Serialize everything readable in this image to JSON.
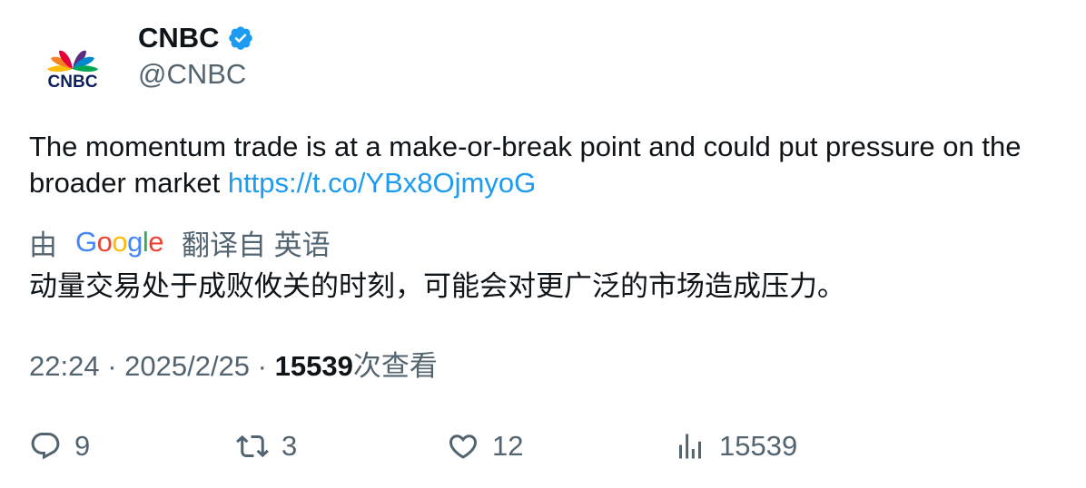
{
  "author": {
    "logo_text": "CNBC",
    "name": "CNBC",
    "handle": "@CNBC",
    "verified": true
  },
  "tweet": {
    "text": "The momentum trade is at a make-or-break point and could put pressure on the broader market ",
    "link": "https://t.co/YBx8OjmyoG"
  },
  "translation": {
    "prefix": "由",
    "provider": "Google",
    "suffix": "翻译自 英语",
    "text": "动量交易处于成败攸关的时刻，可能会对更广泛的市场造成压力。"
  },
  "meta": {
    "time": "22:24",
    "separator": " · ",
    "date": "2025/2/25",
    "views_count": "15539",
    "views_label": "次查看"
  },
  "actions": {
    "replies": "9",
    "retweets": "3",
    "likes": "12",
    "views": "15539"
  },
  "colors": {
    "text": "#0f1419",
    "secondary": "#536471",
    "link": "#1d9bf0",
    "verified": "#1d9bf0",
    "google_blue": "#4285f4",
    "google_red": "#ea4335",
    "google_yellow": "#fbbc05",
    "google_green": "#34a853"
  },
  "icons": {
    "avatar": "cnbc-peacock-logo",
    "verified": "verified-badge-icon",
    "reply": "reply-icon",
    "retweet": "retweet-icon",
    "like": "heart-icon",
    "views": "views-bar-chart-icon"
  }
}
